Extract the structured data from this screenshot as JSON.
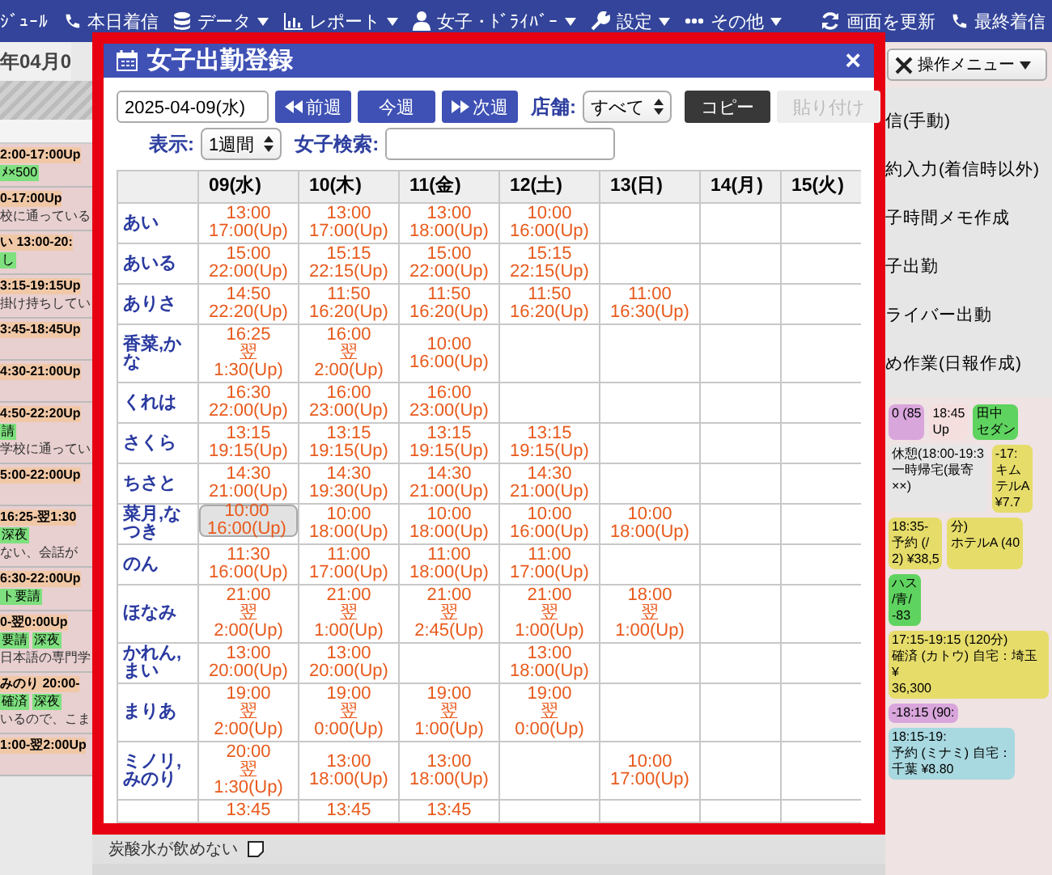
{
  "nav": {
    "items": [
      {
        "label": "ｼﾞｭｰﾙ",
        "dropdown": false
      },
      {
        "label": "本日着信",
        "dropdown": false
      },
      {
        "label": "データ",
        "dropdown": true
      },
      {
        "label": "レポート",
        "dropdown": true
      },
      {
        "label": "女子・ﾄﾞﾗｲﾊﾞｰ",
        "dropdown": true
      },
      {
        "label": "設定",
        "dropdown": true
      },
      {
        "label": "その他",
        "dropdown": true
      }
    ],
    "right_items": [
      {
        "label": "画面を更新"
      },
      {
        "label": "最終着信"
      }
    ]
  },
  "left": {
    "heading": "年04月0",
    "entries": [
      {
        "time": "2:00-17:00Up",
        "tags": [
          "ﾒ×500"
        ]
      },
      {
        "time": "0-17:00Up",
        "note": "校に通っている"
      },
      {
        "time": "い 13:00-20:",
        "tags": [
          "し"
        ]
      },
      {
        "time": "3:15-19:15Up",
        "note": "掛け持ちしてい"
      },
      {
        "time": "3:45-18:45Up"
      },
      {
        "time": "4:30-21:00Up"
      },
      {
        "time": "4:50-22:20Up",
        "tags": [
          "請"
        ],
        "note": "学校に通ってい"
      },
      {
        "time": "5:00-22:00Up"
      },
      {
        "time": "16:25-翌1:30",
        "tags": [
          "深夜"
        ],
        "note": "ない、会話が"
      },
      {
        "time": "6:30-22:00Up",
        "tags": [
          "ト要請"
        ]
      },
      {
        "time": "0-翌0:00Up",
        "tags": [
          "要請",
          "深夜"
        ],
        "note": "日本語の専門学"
      },
      {
        "time": "みのり 20:00-",
        "tags": [
          "確済",
          "深夜"
        ],
        "note": "いるので、こま"
      },
      {
        "time": "1:00-翌2:00Up"
      }
    ]
  },
  "modal": {
    "title": "女子出勤登録",
    "close": "×",
    "date": "2025-04-09(水)",
    "week_buttons": [
      {
        "label": "前週",
        "kind": "prev"
      },
      {
        "label": "今週",
        "kind": "current"
      },
      {
        "label": "次週",
        "kind": "next"
      }
    ],
    "store": {
      "label": "店舗:",
      "value": "すべて"
    },
    "actions": [
      {
        "label": "コピー",
        "disabled": false
      },
      {
        "label": "貼り付け",
        "disabled": true
      }
    ],
    "view": {
      "label": "表示:",
      "value": "1週間"
    },
    "search": {
      "label": "女子検索:"
    },
    "table": {
      "columns": [
        "09(水)",
        "10(木)",
        "11(金)",
        "12(土)",
        "13(日)",
        "14(月)",
        "15(火)"
      ],
      "rows": [
        {
          "name": "あい",
          "cells": [
            {
              "lines": [
                "13:00",
                "17:00(Up)"
              ],
              "selected": false
            },
            {
              "lines": [
                "13:00",
                "17:00(Up)"
              ],
              "selected": false
            },
            {
              "lines": [
                "13:00",
                "18:00(Up)"
              ],
              "selected": false
            },
            {
              "lines": [
                "10:00",
                "16:00(Up)"
              ],
              "selected": false
            },
            null,
            null,
            null
          ]
        },
        {
          "name": "あいる",
          "cells": [
            {
              "lines": [
                "15:00",
                "22:00(Up)"
              ],
              "selected": false
            },
            {
              "lines": [
                "15:15",
                "22:15(Up)"
              ],
              "selected": false
            },
            {
              "lines": [
                "15:00",
                "22:00(Up)"
              ],
              "selected": false
            },
            {
              "lines": [
                "15:15",
                "22:15(Up)"
              ],
              "selected": false
            },
            null,
            null,
            null
          ]
        },
        {
          "name": "ありさ",
          "cells": [
            {
              "lines": [
                "14:50",
                "22:20(Up)"
              ],
              "selected": false
            },
            {
              "lines": [
                "11:50",
                "16:20(Up)"
              ],
              "selected": false
            },
            {
              "lines": [
                "11:50",
                "16:20(Up)"
              ],
              "selected": false
            },
            {
              "lines": [
                "11:50",
                "16:20(Up)"
              ],
              "selected": false
            },
            {
              "lines": [
                "11:00",
                "16:30(Up)"
              ],
              "selected": false
            },
            null,
            null
          ]
        },
        {
          "name": "香菜,かな",
          "cells": [
            {
              "lines": [
                "16:25",
                "翌",
                "1:30(Up)"
              ],
              "selected": false
            },
            {
              "lines": [
                "16:00",
                "翌",
                "2:00(Up)"
              ],
              "selected": false
            },
            {
              "lines": [
                "10:00",
                "16:00(Up)"
              ],
              "selected": false
            },
            null,
            null,
            null,
            null
          ]
        },
        {
          "name": "くれは",
          "cells": [
            {
              "lines": [
                "16:30",
                "22:00(Up)"
              ],
              "selected": false
            },
            {
              "lines": [
                "16:00",
                "23:00(Up)"
              ],
              "selected": false
            },
            {
              "lines": [
                "16:00",
                "23:00(Up)"
              ],
              "selected": false
            },
            null,
            null,
            null,
            null
          ]
        },
        {
          "name": "さくら",
          "cells": [
            {
              "lines": [
                "13:15",
                "19:15(Up)"
              ],
              "selected": false
            },
            {
              "lines": [
                "13:15",
                "19:15(Up)"
              ],
              "selected": false
            },
            {
              "lines": [
                "13:15",
                "19:15(Up)"
              ],
              "selected": false
            },
            {
              "lines": [
                "13:15",
                "19:15(Up)"
              ],
              "selected": false
            },
            null,
            null,
            null
          ]
        },
        {
          "name": "ちさと",
          "cells": [
            {
              "lines": [
                "14:30",
                "21:00(Up)"
              ],
              "selected": false
            },
            {
              "lines": [
                "14:30",
                "19:30(Up)"
              ],
              "selected": false
            },
            {
              "lines": [
                "14:30",
                "21:00(Up)"
              ],
              "selected": false
            },
            {
              "lines": [
                "14:30",
                "21:00(Up)"
              ],
              "selected": false
            },
            null,
            null,
            null
          ]
        },
        {
          "name": "菜月,なつき",
          "cells": [
            {
              "lines": [
                "10:00",
                "16:00(Up)"
              ],
              "selected": true
            },
            {
              "lines": [
                "10:00",
                "18:00(Up)"
              ],
              "selected": false
            },
            {
              "lines": [
                "10:00",
                "18:00(Up)"
              ],
              "selected": false
            },
            {
              "lines": [
                "10:00",
                "16:00(Up)"
              ],
              "selected": false
            },
            {
              "lines": [
                "10:00",
                "18:00(Up)"
              ],
              "selected": false
            },
            null,
            null
          ]
        },
        {
          "name": "のん",
          "cells": [
            {
              "lines": [
                "11:30",
                "16:00(Up)"
              ],
              "selected": false
            },
            {
              "lines": [
                "11:00",
                "17:00(Up)"
              ],
              "selected": false
            },
            {
              "lines": [
                "11:00",
                "18:00(Up)"
              ],
              "selected": false
            },
            {
              "lines": [
                "11:00",
                "17:00(Up)"
              ],
              "selected": false
            },
            null,
            null,
            null
          ]
        },
        {
          "name": "ほなみ",
          "cells": [
            {
              "lines": [
                "21:00",
                "翌",
                "2:00(Up)"
              ],
              "selected": false
            },
            {
              "lines": [
                "21:00",
                "翌",
                "1:00(Up)"
              ],
              "selected": false
            },
            {
              "lines": [
                "21:00",
                "翌",
                "2:45(Up)"
              ],
              "selected": false
            },
            {
              "lines": [
                "21:00",
                "翌",
                "1:00(Up)"
              ],
              "selected": false
            },
            {
              "lines": [
                "18:00",
                "翌",
                "1:00(Up)"
              ],
              "selected": false
            },
            null,
            null
          ]
        },
        {
          "name": "かれん,まい",
          "cells": [
            {
              "lines": [
                "13:00",
                "20:00(Up)"
              ],
              "selected": false
            },
            {
              "lines": [
                "13:00",
                "20:00(Up)"
              ],
              "selected": false
            },
            null,
            {
              "lines": [
                "13:00",
                "18:00(Up)"
              ],
              "selected": false
            },
            null,
            null,
            null
          ]
        },
        {
          "name": "まりあ",
          "cells": [
            {
              "lines": [
                "19:00",
                "翌",
                "2:00(Up)"
              ],
              "selected": false
            },
            {
              "lines": [
                "19:00",
                "翌",
                "0:00(Up)"
              ],
              "selected": false
            },
            {
              "lines": [
                "19:00",
                "翌",
                "1:00(Up)"
              ],
              "selected": false
            },
            {
              "lines": [
                "19:00",
                "翌",
                "0:00(Up)"
              ],
              "selected": false
            },
            null,
            null,
            null
          ]
        },
        {
          "name": "ミノリ,みのり",
          "cells": [
            {
              "lines": [
                "20:00",
                "翌",
                "1:30(Up)"
              ],
              "selected": false
            },
            {
              "lines": [
                "13:00",
                "18:00(Up)"
              ],
              "selected": false
            },
            {
              "lines": [
                "13:00",
                "18:00(Up)"
              ],
              "selected": false
            },
            null,
            {
              "lines": [
                "10:00",
                "17:00(Up)"
              ],
              "selected": false
            },
            null,
            null
          ]
        },
        {
          "cells": [
            {
              "lines": [
                "13:45"
              ],
              "selected": false
            },
            {
              "lines": [
                "13:45"
              ],
              "selected": false
            },
            {
              "lines": [
                "13:45"
              ],
              "selected": false
            },
            null,
            null,
            null,
            null
          ]
        }
      ]
    }
  },
  "bottom_note": "炭酸水が飲めない",
  "right": {
    "menu_button": "操作メニュー",
    "menu_items": [
      "信(手動)",
      "約入力(着信時以外)",
      "子時間メモ作成",
      "子出勤",
      "ライバー出動",
      "め作業(日報作成)"
    ],
    "events": [
      {
        "lines": [
          "0 (85"
        ],
        "color": "#d9a6dc"
      },
      {
        "lines": [
          "18:45",
          "Up"
        ],
        "color": "#f4dede"
      },
      {
        "lines": [
          "田中",
          "セダン"
        ],
        "color": "#5fd35f"
      },
      {
        "lines": [
          "休憩(18:00-19:3",
          "一時帰宅(最寄",
          "××)"
        ],
        "color": "#e6e6e6"
      },
      {
        "lines": [
          "-17:",
          "キム",
          "テルA",
          "¥7.7"
        ],
        "color": "#e6dc6a"
      },
      {
        "lines": [
          "18:35-",
          "予約 (/",
          "2) ¥38,5"
        ],
        "color": "#e6dc6a"
      },
      {
        "lines": [
          "分)",
          "ホテルA (40"
        ],
        "color": "#e6dc6a"
      },
      {
        "lines": [
          "ハス",
          "/青/",
          "-83"
        ],
        "color": "#5fd35f"
      },
      {
        "lines": [
          "17:15-19:15 (120分)",
          "確済 (カトウ) 自宅：埼玉 ¥",
          "36,300"
        ],
        "color": "#e6dc6a"
      },
      {
        "lines": [
          "-18:15 (90:"
        ],
        "color": "#d9a6dc"
      },
      {
        "lines": [
          "18:15-19:",
          "予約 (ミナミ) 自宅：",
          "千葉 ¥8.80"
        ],
        "color": "#a8d8e0"
      }
    ]
  }
}
